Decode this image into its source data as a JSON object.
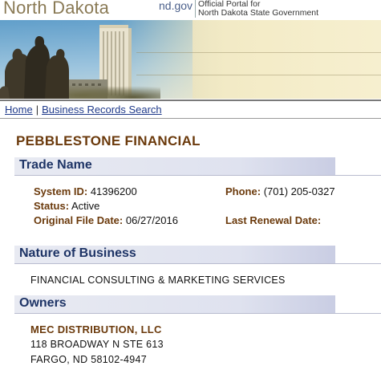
{
  "header": {
    "state_name": "North Dakota",
    "portal_site": "nd.gov",
    "portal_line1": "Official Portal for",
    "portal_line2": "North Dakota State Government"
  },
  "nav": {
    "home": "Home",
    "separator": "|",
    "business_records_search": "Business Records Search"
  },
  "business": {
    "name": "PEBBLESTONE FINANCIAL"
  },
  "trade_name": {
    "heading": "Trade Name",
    "system_id_label": "System ID:",
    "system_id_value": "41396200",
    "status_label": "Status:",
    "status_value": "Active",
    "original_file_date_label": "Original File Date:",
    "original_file_date_value": "06/27/2016",
    "phone_label": "Phone:",
    "phone_value": "(701) 205-0327",
    "last_renewal_label": "Last Renewal Date:",
    "last_renewal_value": ""
  },
  "nature_of_business": {
    "heading": "Nature of Business",
    "description": "FINANCIAL CONSULTING & MARKETING SERVICES"
  },
  "owners": {
    "heading": "Owners",
    "name": "MEC DISTRIBUTION, LLC",
    "address_line1": "118 BROADWAY N STE 613",
    "address_line2": "FARGO, ND 58102-4947"
  },
  "colors": {
    "brown_accent": "#6b3a0c",
    "navy_heading": "#1e3466",
    "link_blue": "#1f3a8a",
    "state_name_tan": "#8a7a55"
  }
}
